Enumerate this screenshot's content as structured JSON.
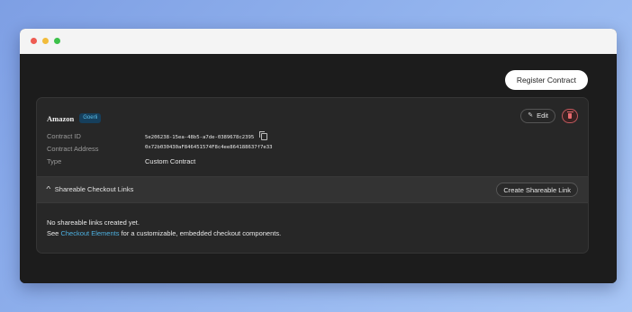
{
  "window": {
    "controls": [
      "close",
      "minimize",
      "maximize"
    ]
  },
  "toolbar": {
    "register_label": "Register Contract"
  },
  "contract": {
    "name": "Amazon",
    "network": "Goerli",
    "edit_label": "Edit",
    "fields": [
      {
        "label": "Contract ID",
        "value": "5e206238-15ea-48b5-a7de-0389678c2395"
      },
      {
        "label": "Contract Address",
        "value": "0x72b030430aF846451574F8c4ee864188637f7e33"
      },
      {
        "label": "Type",
        "value": "Custom Contract"
      }
    ]
  },
  "links": {
    "section_title": "Shareable Checkout Links",
    "create_label": "Create Shareable Link",
    "empty_line1": "No shareable links created yet.",
    "empty_prefix": "See ",
    "empty_link": "Checkout Elements",
    "empty_suffix": " for a customizable, embedded checkout components."
  },
  "colors": {
    "background": "#1c1c1c",
    "card": "#272727",
    "badge_text": "#5cc0ea",
    "link": "#4db0e0",
    "delete": "#e86a6e"
  },
  "icons": [
    "pencil-icon",
    "trash-icon",
    "copy-icon",
    "chevron-up-icon"
  ]
}
